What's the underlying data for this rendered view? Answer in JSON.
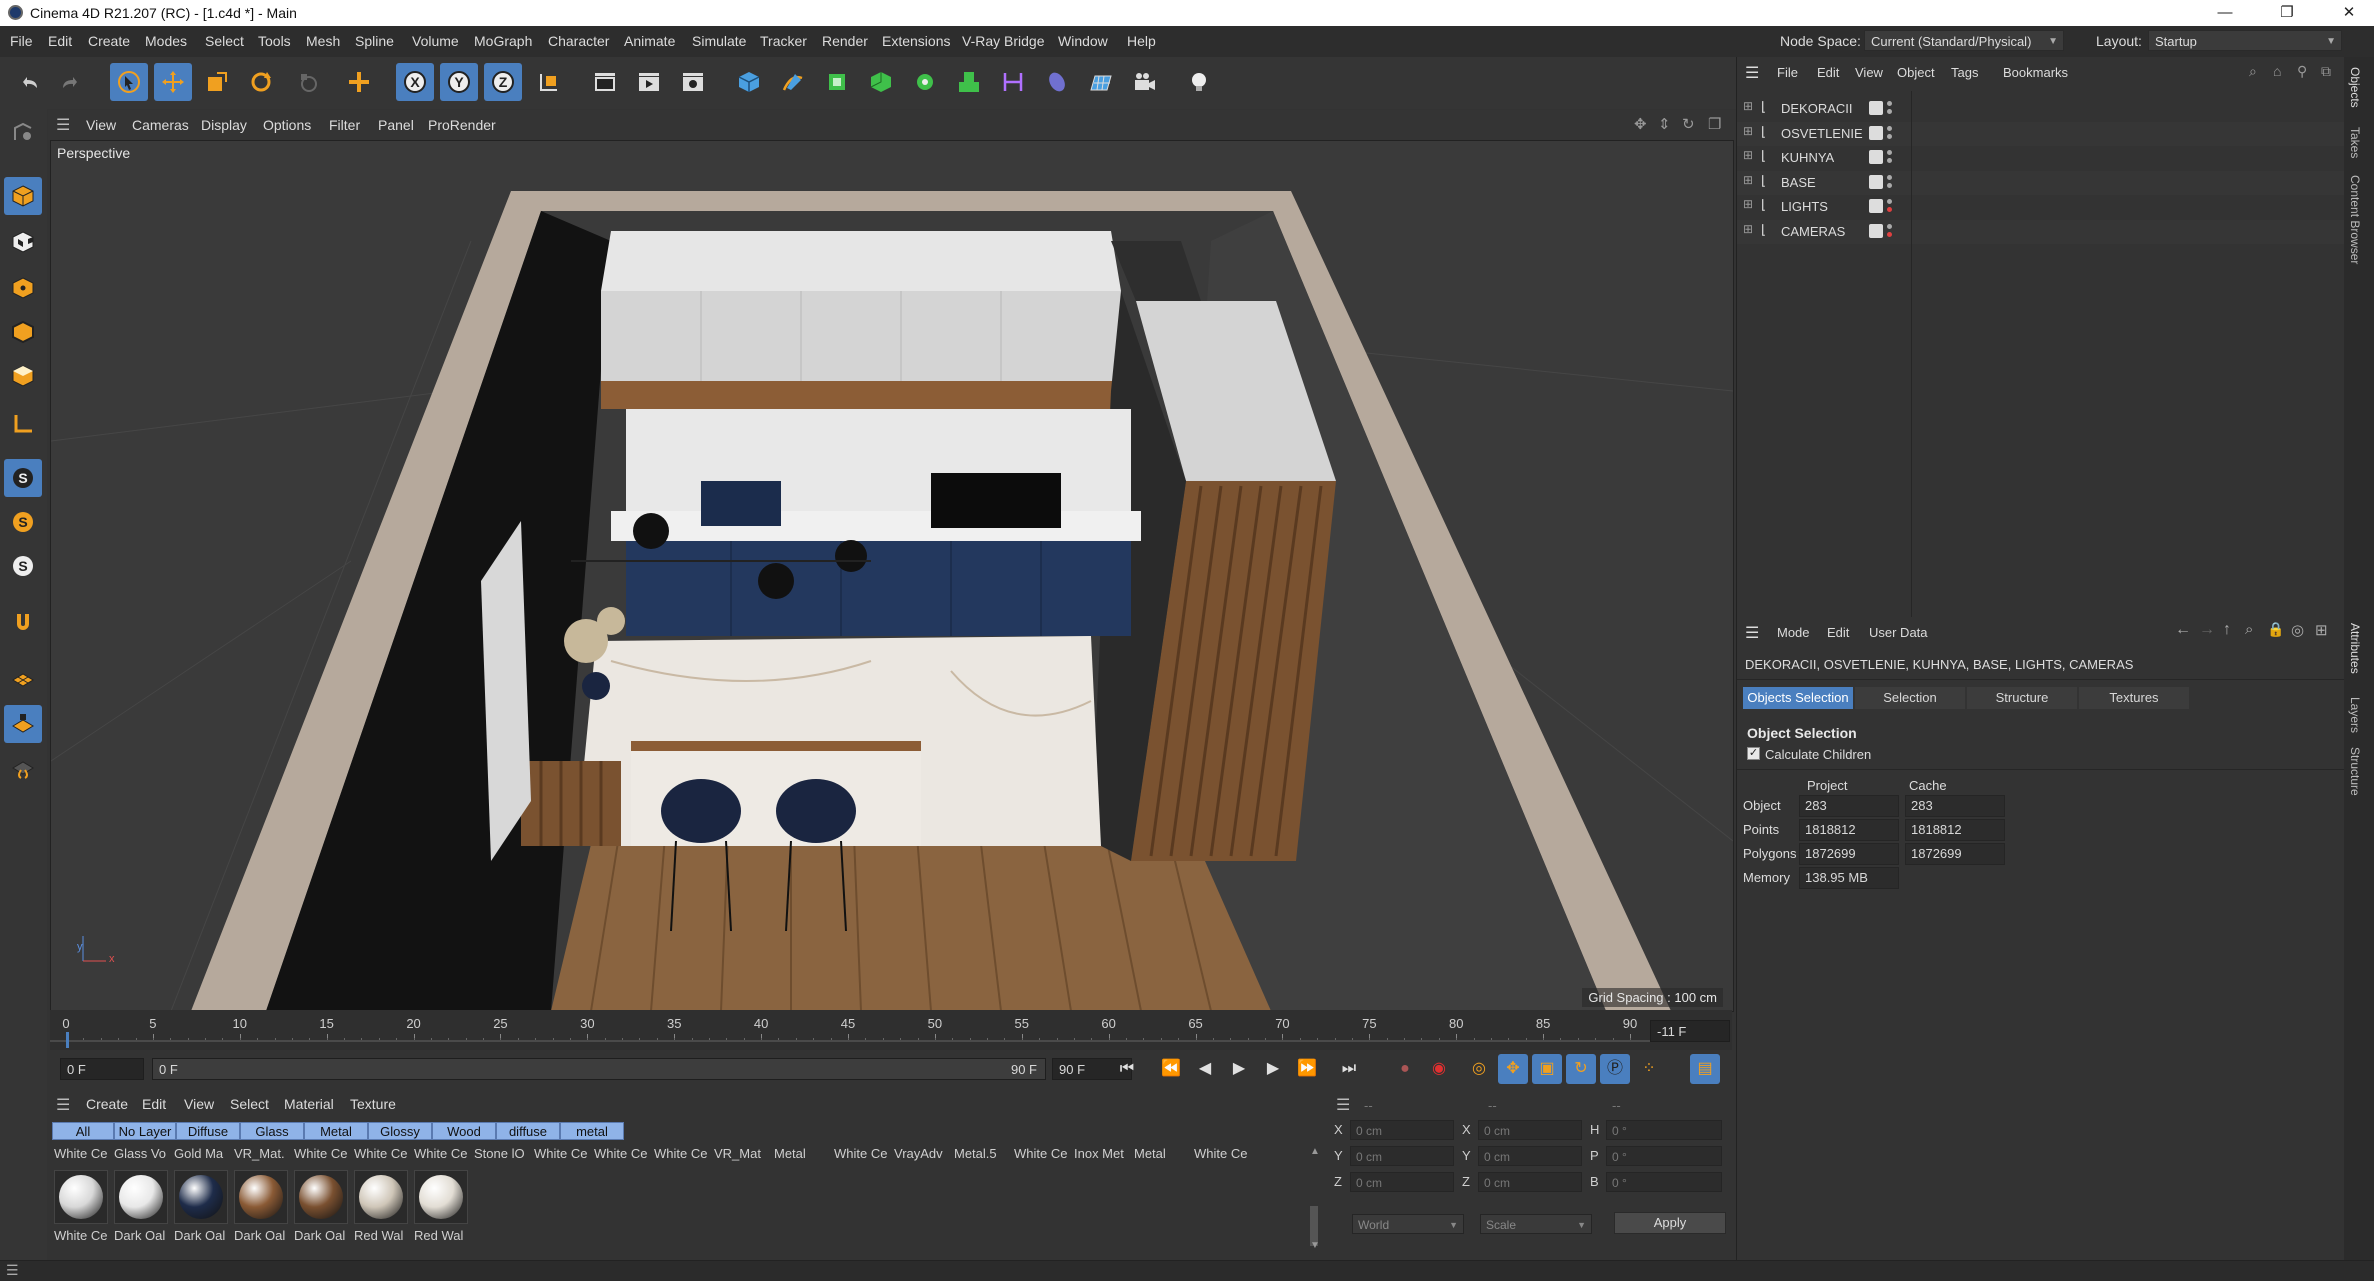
{
  "window": {
    "title": "Cinema 4D R21.207 (RC) - [1.c4d *] - Main",
    "controls": [
      "—",
      "❐",
      "✕"
    ]
  },
  "menubar": {
    "items": [
      "File",
      "Edit",
      "Create",
      "Modes",
      "Select",
      "Tools",
      "Mesh",
      "Spline",
      "Volume",
      "MoGraph",
      "Character",
      "Animate",
      "Simulate",
      "Tracker",
      "Render",
      "Extensions",
      "V-Ray Bridge",
      "Window",
      "Help"
    ],
    "node_space_label": "Node Space:",
    "node_space_value": "Current (Standard/Physical)",
    "layout_label": "Layout:",
    "layout_value": "Startup"
  },
  "viewport": {
    "menu": [
      "View",
      "Cameras",
      "Display",
      "Options",
      "Filter",
      "Panel",
      "ProRender"
    ],
    "label": "Perspective",
    "grid_spacing": "Grid Spacing : 100 cm",
    "axis_y": "y",
    "axis_x": "x"
  },
  "timeline": {
    "ticks": [
      "0",
      "5",
      "10",
      "15",
      "20",
      "25",
      "30",
      "35",
      "40",
      "45",
      "50",
      "55",
      "60",
      "65",
      "70",
      "75",
      "80",
      "85",
      "90"
    ],
    "current_field": "-11 F",
    "start_frame": "0 F",
    "range_start": "0 F",
    "range_end": "90 F",
    "end_frame": "90 F"
  },
  "material_manager": {
    "menu": [
      "Create",
      "Edit",
      "View",
      "Select",
      "Material",
      "Texture"
    ],
    "filter_tabs": [
      "All",
      "No Layer",
      "Diffuse",
      "Glass",
      "Metal",
      "Glossy",
      "Wood",
      "diffuse",
      "metal"
    ],
    "row1_names": [
      "White Ce",
      "Glass Vo",
      "Gold Ma",
      "VR_Mat.",
      "White Ce",
      "White Ce",
      "White Ce",
      "Stone lO",
      "White Ce",
      "White Ce",
      "White Ce",
      "VR_Mat",
      "Metal",
      "White Ce",
      "VrayAdv",
      "Metal.5",
      "White Ce",
      "Inox Met",
      "Metal",
      "White Ce"
    ],
    "row2_names": [
      "White Ce",
      "Dark Oal",
      "Dark Oal",
      "Dark Oal",
      "Dark Oal",
      "Red Wal",
      "Red Wal"
    ],
    "row2_colors": [
      "#d8d8d8",
      "#e8e8e8",
      "#1e2c4a",
      "#8a5a35",
      "#7a5030",
      "#cfc6b8",
      "#e2ddd4"
    ]
  },
  "coordinates": {
    "header_labels": [
      "--",
      "--",
      "--"
    ],
    "rows": [
      {
        "a": "X",
        "av": "0 cm",
        "b": "X",
        "bv": "0 cm",
        "c": "H",
        "cv": "0 °"
      },
      {
        "a": "Y",
        "av": "0 cm",
        "b": "Y",
        "bv": "0 cm",
        "c": "P",
        "cv": "0 °"
      },
      {
        "a": "Z",
        "av": "0 cm",
        "b": "Z",
        "bv": "0 cm",
        "c": "B",
        "cv": "0 °"
      }
    ],
    "mode_world": "World",
    "mode_scale": "Scale",
    "apply": "Apply"
  },
  "object_manager": {
    "menu": [
      "File",
      "Edit",
      "View",
      "Object",
      "Tags",
      "Bookmarks"
    ],
    "objects": [
      {
        "name": "DEKORACII",
        "dot": "#aaaaaa"
      },
      {
        "name": "OSVETLENIE",
        "dot": "#aaaaaa"
      },
      {
        "name": "KUHNYA",
        "dot": "#aaaaaa"
      },
      {
        "name": "BASE",
        "dot": "#aaaaaa"
      },
      {
        "name": "LIGHTS",
        "dot": "#e04040"
      },
      {
        "name": "CAMERAS",
        "dot": "#e04040"
      }
    ]
  },
  "attributes": {
    "menu": [
      "Mode",
      "Edit",
      "User Data"
    ],
    "selection_summary": "DEKORACII, OSVETLENIE, KUHNYA, BASE, LIGHTS, CAMERAS",
    "tabs": [
      "Objects Selection",
      "Selection",
      "Structure",
      "Textures"
    ],
    "section_title": "Object Selection",
    "calculate_children": "Calculate Children",
    "col_project": "Project",
    "col_cache": "Cache",
    "stats": [
      {
        "label": "Object",
        "project": "283",
        "cache": "283"
      },
      {
        "label": "Points",
        "project": "1818812",
        "cache": "1818812"
      },
      {
        "label": "Polygons",
        "project": "1872699",
        "cache": "1872699"
      },
      {
        "label": "Memory",
        "project": "138.95 MB",
        "cache": ""
      }
    ]
  },
  "side_tabs": [
    "Objects",
    "Takes",
    "Content Browser",
    "Attributes",
    "Layers",
    "Structure"
  ],
  "colors": {
    "accent": "#4a7fbf",
    "orange": "#f0a020",
    "bg": "#333333"
  }
}
